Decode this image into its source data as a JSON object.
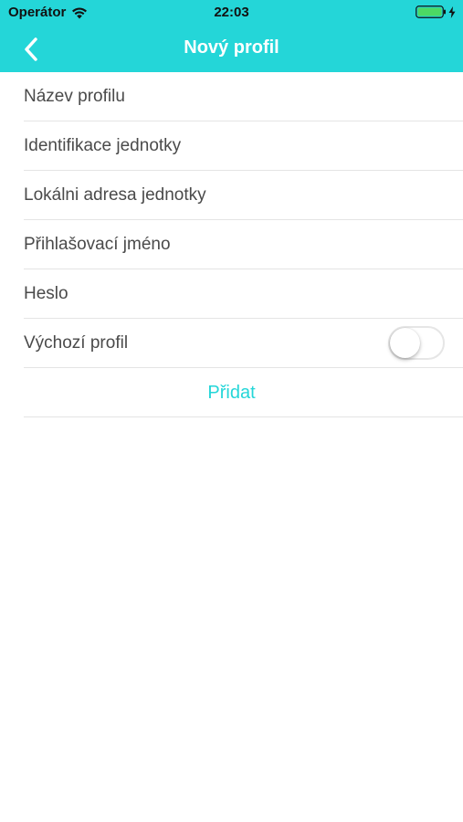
{
  "status_bar": {
    "carrier": "Operátor",
    "time": "22:03",
    "battery_color": "#4cd964"
  },
  "nav": {
    "title": "Nový profil",
    "background_color": "#24d6d8"
  },
  "form": {
    "fields": [
      {
        "placeholder": "Název profilu",
        "value": ""
      },
      {
        "placeholder": "Identifikace jednotky",
        "value": ""
      },
      {
        "placeholder": "Lokálni adresa jednotky",
        "value": ""
      },
      {
        "placeholder": "Přihlašovací jméno",
        "value": ""
      },
      {
        "placeholder": "Heslo",
        "value": ""
      }
    ],
    "default_profile_label": "Výchozí profil",
    "default_profile_on": false,
    "add_label": "Přidat"
  }
}
